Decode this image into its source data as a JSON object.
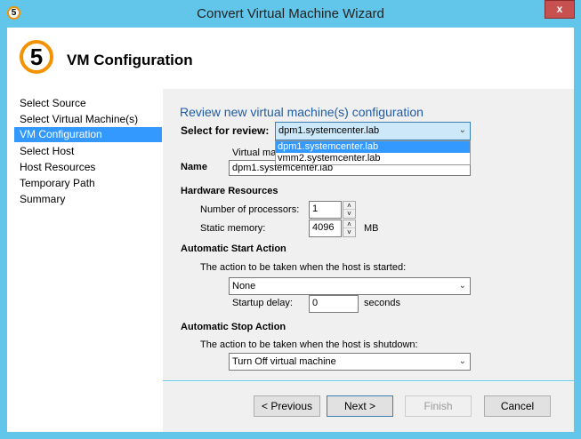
{
  "window": {
    "title": "Convert Virtual Machine Wizard",
    "close_label": "x",
    "step_number": "5"
  },
  "header": {
    "title": "VM Configuration"
  },
  "sidebar": {
    "items": [
      {
        "label": "Select Source"
      },
      {
        "label": "Select Virtual Machine(s)"
      },
      {
        "label": "VM Configuration",
        "selected": true
      },
      {
        "label": "Select Host"
      },
      {
        "label": "Host Resources"
      },
      {
        "label": "Temporary Path"
      },
      {
        "label": "Summary"
      }
    ]
  },
  "main": {
    "heading": "Review new virtual machine(s) configuration",
    "select_label": "Select for review:",
    "select_value": "dpm1.systemcenter.lab",
    "dropdown_options": [
      "dpm1.systemcenter.lab",
      "vmm2.systemcenter.lab"
    ],
    "hidden_label": "Virtual mac",
    "name_label": "Name",
    "name_value": "dpm1.systemcenter.lab",
    "hardware_heading": "Hardware Resources",
    "processors_label": "Number of processors:",
    "processors_value": "1",
    "memory_label": "Static memory:",
    "memory_value": "4096",
    "memory_unit": "MB",
    "start_heading": "Automatic Start Action",
    "start_desc": "The action to be taken when the host is started:",
    "start_value": "None",
    "delay_label": "Startup delay:",
    "delay_value": "0",
    "delay_unit": "seconds",
    "stop_heading": "Automatic Stop Action",
    "stop_desc": "The action to be taken when the host is shutdown:",
    "stop_value": "Turn Off virtual machine"
  },
  "footer": {
    "previous": "< Previous",
    "next": "Next >",
    "finish": "Finish",
    "cancel": "Cancel"
  },
  "colors": {
    "frame": "#62c6ea",
    "accent": "#3399ff",
    "heading": "#1e5ba8",
    "step_icon": "#f39200",
    "close": "#c75050"
  }
}
